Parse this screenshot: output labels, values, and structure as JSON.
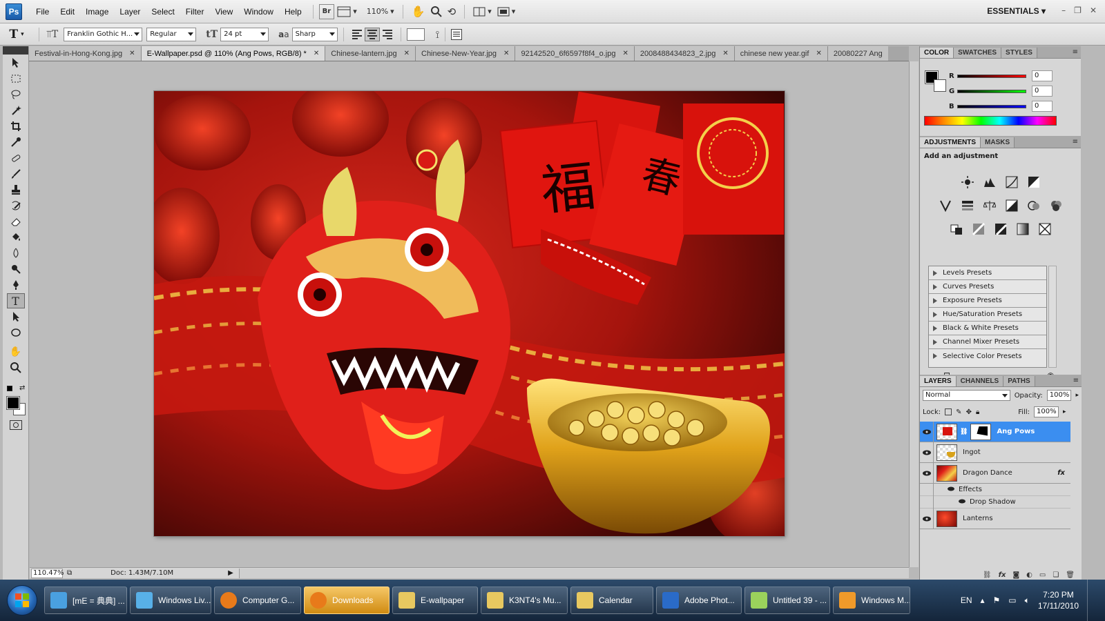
{
  "menubar": {
    "items": [
      "File",
      "Edit",
      "Image",
      "Layer",
      "Select",
      "Filter",
      "View",
      "Window",
      "Help"
    ],
    "bridge_label": "Br",
    "zoom": "110%",
    "workspace": "ESSENTIALS"
  },
  "options": {
    "font_family": "Franklin Gothic H...",
    "font_style": "Regular",
    "font_size": "24 pt",
    "antialias": "Sharp",
    "aa_label": "a"
  },
  "tabs": [
    {
      "label": "Festival-in-Hong-Kong.jpg",
      "active": false
    },
    {
      "label": "E-Wallpaper.psd @ 110% (Ang Pows, RGB/8) *",
      "active": true
    },
    {
      "label": "Chinese-lantern.jpg",
      "active": false
    },
    {
      "label": "Chinese-New-Year.jpg",
      "active": false
    },
    {
      "label": "92142520_6f6597f8f4_o.jpg",
      "active": false
    },
    {
      "label": "2008488434823_2.jpg",
      "active": false
    },
    {
      "label": "chinese new year.gif",
      "active": false
    },
    {
      "label": "20080227 Ang",
      "active": false
    }
  ],
  "status": {
    "zoom": "110.47%",
    "doc": "Doc: 1.43M/7.10M"
  },
  "color_panel": {
    "tabs": [
      "COLOR",
      "SWATCHES",
      "STYLES"
    ],
    "r": "0",
    "g": "0",
    "b": "0",
    "r_label": "R",
    "g_label": "G",
    "b_label": "B"
  },
  "adjustments": {
    "tabs": [
      "ADJUSTMENTS",
      "MASKS"
    ],
    "title": "Add an adjustment",
    "presets": [
      "Levels Presets",
      "Curves Presets",
      "Exposure Presets",
      "Hue/Saturation Presets",
      "Black & White Presets",
      "Channel Mixer Presets",
      "Selective Color Presets"
    ]
  },
  "layers_panel": {
    "tabs": [
      "LAYERS",
      "CHANNELS",
      "PATHS"
    ],
    "blend_mode": "Normal",
    "opacity_label": "Opacity:",
    "opacity": "100%",
    "lock_label": "Lock:",
    "fill_label": "Fill:",
    "fill": "100%",
    "layers": [
      "Ang Pows",
      "Ingot",
      "Dragon Dance",
      "Lanterns"
    ],
    "effects_label": "Effects",
    "drop_shadow_label": "Drop Shadow",
    "fx_label": "fx"
  },
  "taskbar": {
    "items": [
      {
        "label": "[mE = 典典] ...",
        "icon_color": "#4aa0e0",
        "active": false
      },
      {
        "label": "Windows Liv...",
        "icon_color": "#58b0e8",
        "active": false
      },
      {
        "label": "Computer G...",
        "icon_color": "#e87a1a",
        "active": false
      },
      {
        "label": "Downloads",
        "icon_color": "#e87a1a",
        "active": true
      },
      {
        "label": "E-wallpaper",
        "icon_color": "#e8c860",
        "active": false
      },
      {
        "label": "K3NT4's Mu...",
        "icon_color": "#e8c860",
        "active": false
      },
      {
        "label": "Calendar",
        "icon_color": "#e8c860",
        "active": false
      },
      {
        "label": "Adobe Phot...",
        "icon_color": "#2a6bc8",
        "active": false
      },
      {
        "label": "Untitled 39 - ...",
        "icon_color": "#9bd25c",
        "active": false
      },
      {
        "label": "Windows M...",
        "icon_color": "#f09a2a",
        "active": false
      }
    ],
    "lang": "EN",
    "time": "7:20 PM",
    "date": "17/11/2010"
  }
}
